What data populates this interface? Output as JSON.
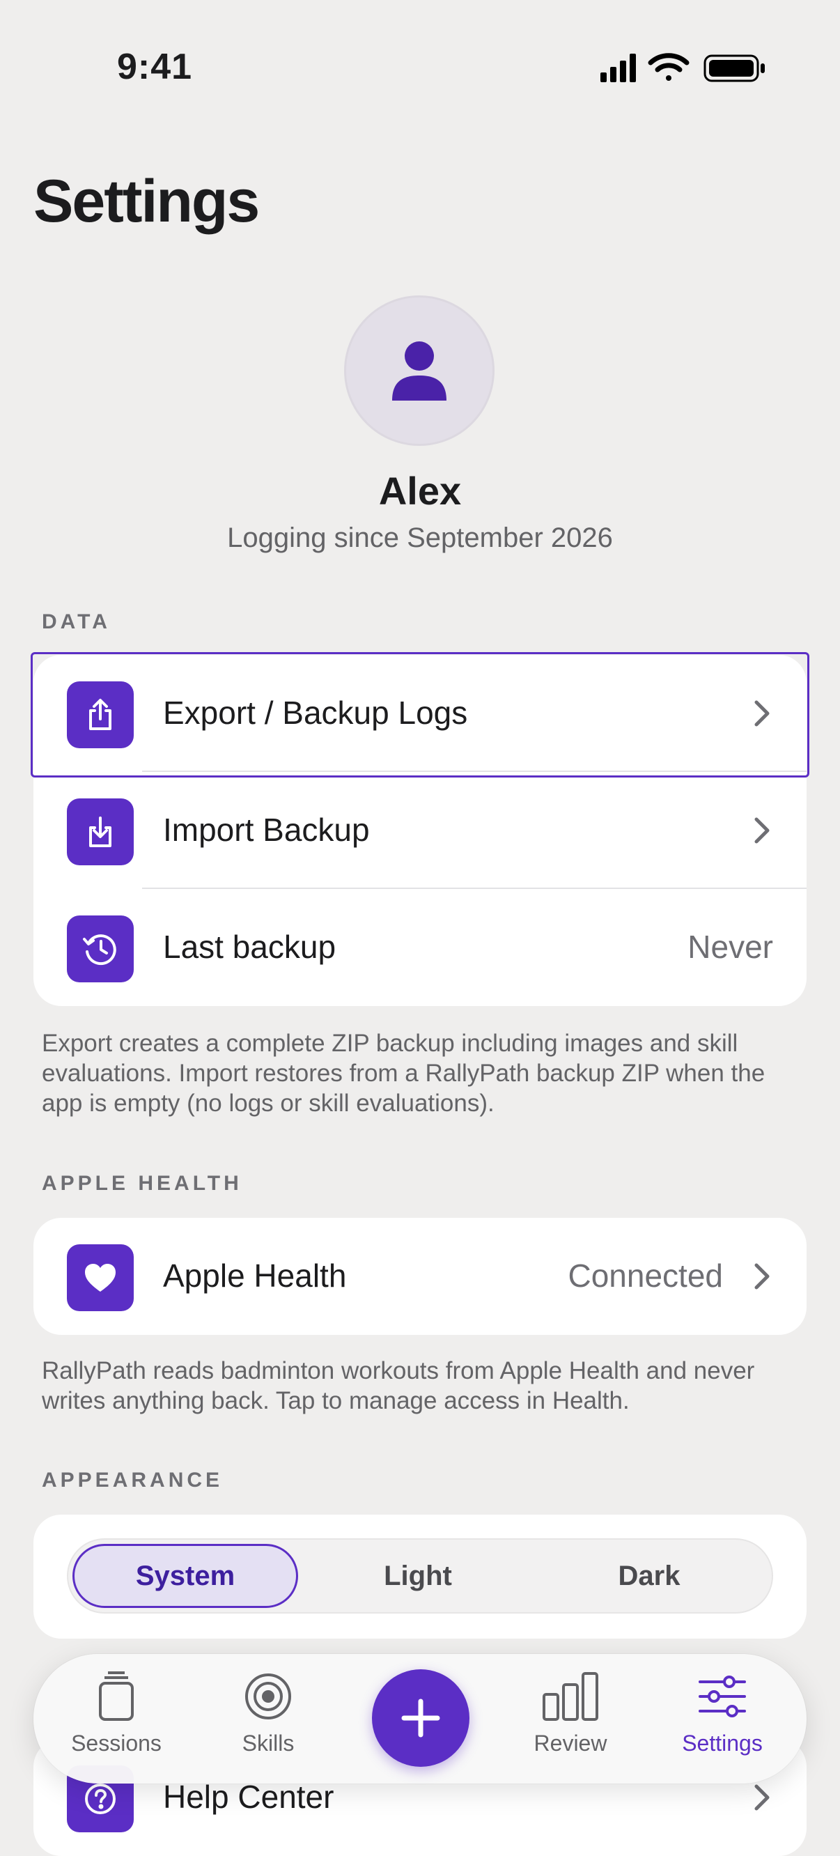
{
  "status_bar": {
    "time": "9:41"
  },
  "page": {
    "title": "Settings"
  },
  "profile": {
    "name": "Alex",
    "subtitle": "Logging since September 2026"
  },
  "data_section": {
    "header": "DATA",
    "rows": [
      {
        "label": "Export / Backup Logs",
        "icon": "export-icon"
      },
      {
        "label": "Import Backup",
        "icon": "import-icon"
      },
      {
        "label": "Last backup",
        "value": "Never",
        "icon": "history-icon"
      }
    ],
    "footnote": "Export creates a complete ZIP backup including images and skill evaluations. Import restores from a RallyPath backup ZIP when the app is empty (no logs or skill evaluations)."
  },
  "health_section": {
    "header": "APPLE HEALTH",
    "row": {
      "label": "Apple Health",
      "value": "Connected",
      "icon": "heart-icon"
    },
    "footnote": "RallyPath reads badminton workouts from Apple Health and never writes anything back. Tap to manage access in Health."
  },
  "appearance_section": {
    "header": "APPEARANCE",
    "options": [
      "System",
      "Light",
      "Dark"
    ],
    "selected": "System"
  },
  "help_section": {
    "row": {
      "label": "Help Center",
      "icon": "question-icon"
    }
  },
  "tab_bar": {
    "tabs": [
      {
        "label": "Sessions",
        "icon": "sessions-icon"
      },
      {
        "label": "Skills",
        "icon": "target-icon"
      },
      {
        "label": "Review",
        "icon": "bar-chart-icon"
      },
      {
        "label": "Settings",
        "icon": "sliders-icon"
      }
    ],
    "active": "Settings",
    "add_icon": "plus-icon"
  },
  "colors": {
    "accent": "#5b2ec5",
    "background": "#efeeed",
    "card": "#ffffff"
  }
}
